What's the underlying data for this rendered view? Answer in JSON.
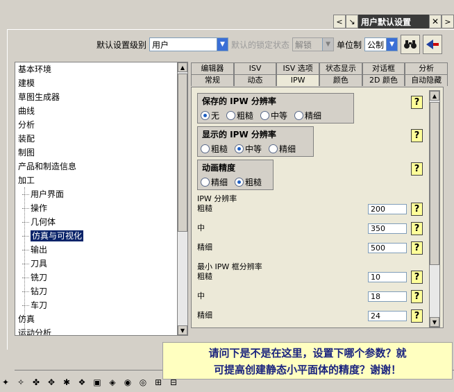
{
  "titlebar": {
    "title": "用户默认设置",
    "left_arrow": "<",
    "pin": "↘",
    "close": "✕",
    "right_arrow": ">"
  },
  "toolbar": {
    "level_label": "默认设置级别",
    "level_value": "用户",
    "lock_label": "默认的锁定状态",
    "lock_value": "解锁",
    "unit_label": "单位制",
    "unit_value": "公制"
  },
  "tree": {
    "items": [
      {
        "label": "基本环境",
        "child": false
      },
      {
        "label": "建模",
        "child": false
      },
      {
        "label": "草图生成器",
        "child": false
      },
      {
        "label": "曲线",
        "child": false
      },
      {
        "label": "分析",
        "child": false
      },
      {
        "label": "装配",
        "child": false
      },
      {
        "label": "制图",
        "child": false
      },
      {
        "label": "产品和制造信息",
        "child": false
      },
      {
        "label": "加工",
        "child": false
      },
      {
        "label": "用户界面",
        "child": true
      },
      {
        "label": "操作",
        "child": true
      },
      {
        "label": "几何体",
        "child": true
      },
      {
        "label": "仿真与可视化",
        "child": true,
        "selected": true
      },
      {
        "label": "输出",
        "child": true
      },
      {
        "label": "刀具",
        "child": true
      },
      {
        "label": "铣刀",
        "child": true
      },
      {
        "label": "钻刀",
        "child": true
      },
      {
        "label": "车刀",
        "child": true
      },
      {
        "label": "仿真",
        "child": false
      },
      {
        "label": "运动分析",
        "child": false
      }
    ]
  },
  "tabs": {
    "row1": [
      "编辑器",
      "ISV",
      "ISV 选项",
      "状态显示",
      "对话框",
      "分析"
    ],
    "row2": [
      "常规",
      "动态",
      "IPW",
      "颜色",
      "2D 颜色",
      "自动隐藏"
    ],
    "active": "IPW"
  },
  "ipw": {
    "saved_title": "保存的 IPW 分辨率",
    "saved_options": [
      "无",
      "粗糙",
      "中等",
      "精细"
    ],
    "saved_selected": "无",
    "display_title": "显示的 IPW 分辨率",
    "display_options": [
      "粗糙",
      "中等",
      "精细"
    ],
    "display_selected": "中等",
    "anim_title": "动画精度",
    "anim_options": [
      "精细",
      "粗糙"
    ],
    "anim_selected": "粗糙",
    "res_title": "IPW 分辨率",
    "res_rows": [
      {
        "label": "粗糙",
        "value": "200"
      },
      {
        "label": "中",
        "value": "350"
      },
      {
        "label": "精细",
        "value": "500"
      }
    ],
    "min_title": "最小 IPW 框分辨率",
    "min_rows": [
      {
        "label": "粗糙",
        "value": "10"
      },
      {
        "label": "中",
        "value": "18"
      },
      {
        "label": "精细",
        "value": "24"
      }
    ],
    "help": "?"
  },
  "note": {
    "line1": "请问下是不是在这里，设置下哪个参数？就",
    "line2": "可提高创建静态小平面体的精度？谢谢！"
  },
  "colors": {
    "selection": "#0a246a",
    "help_bg": "#ffff99",
    "note_text": "#1a237e"
  }
}
